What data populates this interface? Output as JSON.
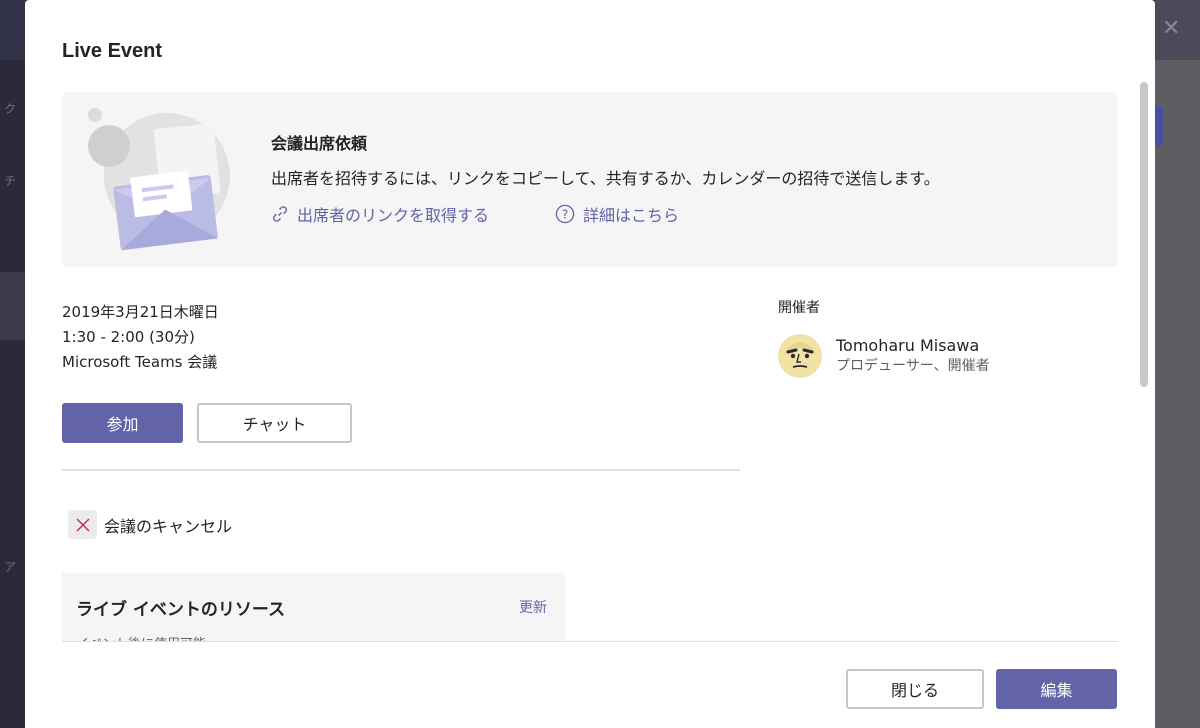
{
  "background": {
    "left_glyphs": [
      "ク",
      "チ",
      "ア"
    ]
  },
  "dialog": {
    "title": "Live Event",
    "invite": {
      "title": "会議出席依頼",
      "description": "出席者を招待するには、リンクをコピーして、共有するか、カレンダーの招待で送信します。",
      "link_label": "出席者のリンクを取得する",
      "help_label": "詳細はこちら"
    },
    "meeting": {
      "date": "2019年3月21日木曜日",
      "time": "1:30 - 2:00 (30分)",
      "type": "Microsoft Teams 会議"
    },
    "buttons": {
      "join": "参加",
      "chat": "チャット",
      "close": "閉じる",
      "edit": "編集"
    },
    "cancel_label": "会議のキャンセル",
    "resources": {
      "title": "ライブ イベントのリソース",
      "update": "更新",
      "subtitle": "イベント後に使用可能"
    },
    "organizer": {
      "label": "開催者",
      "name": "Tomoharu Misawa",
      "role": "プロデューサー、開催者"
    }
  },
  "colors": {
    "accent": "#6264a7",
    "card_bg": "#f5f5f5",
    "cancel_red": "#c4314b"
  },
  "icons": {
    "link": "link-icon",
    "help": "help-circle-icon",
    "cancel": "close-x-icon",
    "illustration": "envelope-illustration"
  }
}
